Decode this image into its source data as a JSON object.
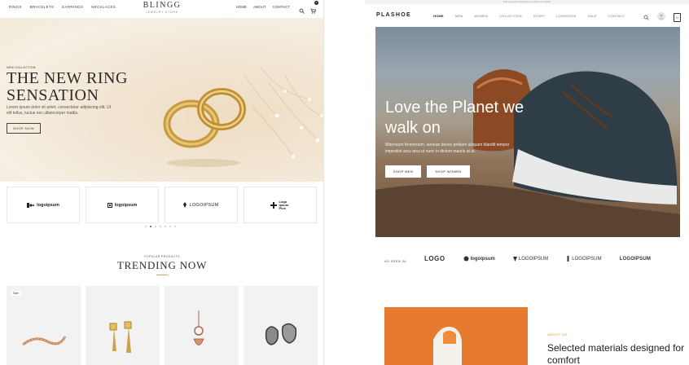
{
  "left": {
    "nav": [
      "RINGS",
      "BRACELETS",
      "EARRINGS",
      "NECKLACES"
    ],
    "brand": "BLINGG",
    "brand_sub": "JEWELRY STORE",
    "right_nav": [
      "HOME",
      "ABOUT",
      "CONTACT"
    ],
    "cart_count": "0",
    "hero": {
      "eyebrow": "NEW COLLECTION",
      "title": "THE NEW RING SENSATION",
      "description": "Lorem ipsum dolor sit amet, consectetur adipiscing elit. Ut elit tellus, luctus nec ullamcorper mattis.",
      "button": "SHOP NOW"
    },
    "logos": [
      "logoipsum",
      "logoipsum",
      "LOGOIPSUM",
      "Logo Ipsum Plus"
    ],
    "section_eyebrow": "POPULAR PRODUCTS",
    "section_title": "TRENDING NOW",
    "products": [
      {
        "badge": "Sale"
      },
      {
        "badge": ""
      },
      {
        "badge": ""
      },
      {
        "badge": ""
      }
    ]
  },
  "right": {
    "topbar": "Enjoy express shipping on orders over $100",
    "brand": "PLASHOE",
    "nav": [
      "HOME",
      "MEN",
      "WOMEN",
      "COLLECTION",
      "STORY",
      "LOOKBOOK",
      "SALE",
      "CONTACT"
    ],
    "cart_count": "0",
    "hero": {
      "title": "Love the Planet we walk on",
      "description": "Bibendum fermentum, aenean donec pretium aliquam blandit tempor imperdiet arcu arcu ut nunc in dictum mauris at ut.",
      "button_men": "SHOP MEN",
      "button_women": "SHOP WOMEN"
    },
    "as_seen_in": "AS SEEN IN:",
    "logos": [
      "LOGO",
      "logoipsum",
      "LOGOIPSUM",
      "LOGOIPSUM",
      "LOGOIPSUM"
    ],
    "about_eyebrow": "ABOUT US",
    "about_heading": "Selected materials designed for comfort"
  },
  "colors": {
    "gold": "#c9a56b",
    "accent_orange": "#e87a2f"
  }
}
